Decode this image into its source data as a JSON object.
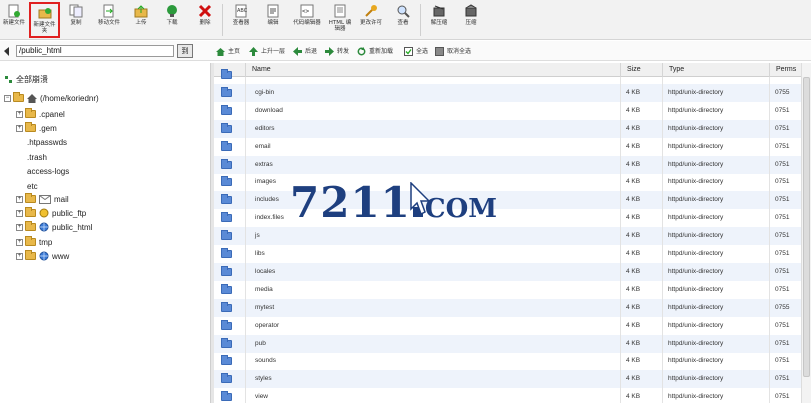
{
  "toolbar": {
    "items": [
      {
        "label": "新建文件",
        "icon": "new-file-icon"
      },
      {
        "label": "新建文件夹",
        "icon": "new-folder-icon"
      },
      {
        "label": "复制",
        "icon": "copy-icon"
      },
      {
        "label": "移动文件",
        "icon": "move-file-icon"
      },
      {
        "label": "上传",
        "icon": "upload-icon"
      },
      {
        "label": "下载",
        "icon": "download-icon"
      },
      {
        "label": "删除",
        "icon": "delete-icon"
      },
      {
        "label": "查看器",
        "icon": "viewer-icon"
      },
      {
        "label": "编辑",
        "icon": "edit-icon"
      },
      {
        "label": "代码编辑器",
        "icon": "code-editor-icon"
      },
      {
        "label": "HTML 编辑器",
        "icon": "html-editor-icon"
      },
      {
        "label": "更改许可",
        "icon": "permissions-icon"
      },
      {
        "label": "查看",
        "icon": "view-icon"
      },
      {
        "label": "解压缩",
        "icon": "extract-icon"
      },
      {
        "label": "压缩",
        "icon": "compress-icon"
      }
    ]
  },
  "pathbar": {
    "path": "/public_html",
    "go_label": "到"
  },
  "nav": {
    "home": "主页",
    "up": "上升一层",
    "back": "后退",
    "forward": "转发",
    "reload": "重新加载",
    "select_all": "全选",
    "deselect_all": "取消全选"
  },
  "tree": {
    "collapse_all": "全部崩溃",
    "root": "(/home/koriednr)",
    "items": [
      ".cpanel",
      ".gem",
      ".htpasswds",
      ".trash",
      "access-logs",
      "etc",
      "mail",
      "public_ftp",
      "public_html",
      "tmp",
      "www"
    ]
  },
  "table": {
    "headers": {
      "name": "Name",
      "size": "Size",
      "type": "Type",
      "perms": "Perms"
    },
    "rows": [
      {
        "name": "",
        "size": "",
        "type": "",
        "perms": ""
      },
      {
        "name": "cgi-bin",
        "size": "4 KB",
        "type": "httpd/unix-directory",
        "perms": "0755"
      },
      {
        "name": "download",
        "size": "4 KB",
        "type": "httpd/unix-directory",
        "perms": "0751"
      },
      {
        "name": "editors",
        "size": "4 KB",
        "type": "httpd/unix-directory",
        "perms": "0751"
      },
      {
        "name": "email",
        "size": "4 KB",
        "type": "httpd/unix-directory",
        "perms": "0751"
      },
      {
        "name": "extras",
        "size": "4 KB",
        "type": "httpd/unix-directory",
        "perms": "0751"
      },
      {
        "name": "images",
        "size": "4 KB",
        "type": "httpd/unix-directory",
        "perms": "0751"
      },
      {
        "name": "includes",
        "size": "4 KB",
        "type": "httpd/unix-directory",
        "perms": "0751"
      },
      {
        "name": "index.files",
        "size": "4 KB",
        "type": "httpd/unix-directory",
        "perms": "0751"
      },
      {
        "name": "js",
        "size": "4 KB",
        "type": "httpd/unix-directory",
        "perms": "0751"
      },
      {
        "name": "libs",
        "size": "4 KB",
        "type": "httpd/unix-directory",
        "perms": "0751"
      },
      {
        "name": "locales",
        "size": "4 KB",
        "type": "httpd/unix-directory",
        "perms": "0751"
      },
      {
        "name": "media",
        "size": "4 KB",
        "type": "httpd/unix-directory",
        "perms": "0751"
      },
      {
        "name": "mytest",
        "size": "4 KB",
        "type": "httpd/unix-directory",
        "perms": "0755"
      },
      {
        "name": "operator",
        "size": "4 KB",
        "type": "httpd/unix-directory",
        "perms": "0751"
      },
      {
        "name": "pub",
        "size": "4 KB",
        "type": "httpd/unix-directory",
        "perms": "0751"
      },
      {
        "name": "sounds",
        "size": "4 KB",
        "type": "httpd/unix-directory",
        "perms": "0751"
      },
      {
        "name": "styles",
        "size": "4 KB",
        "type": "httpd/unix-directory",
        "perms": "0751"
      },
      {
        "name": "view",
        "size": "4 KB",
        "type": "httpd/unix-directory",
        "perms": "0751"
      }
    ]
  },
  "watermark": {
    "digits": "7211",
    "suffix": "COM"
  },
  "colors": {
    "accent_red": "#e02020",
    "folder_blue": "#5a8ad6",
    "folder_yellow": "#e8b84a",
    "watermark": "#1e3f7f"
  }
}
